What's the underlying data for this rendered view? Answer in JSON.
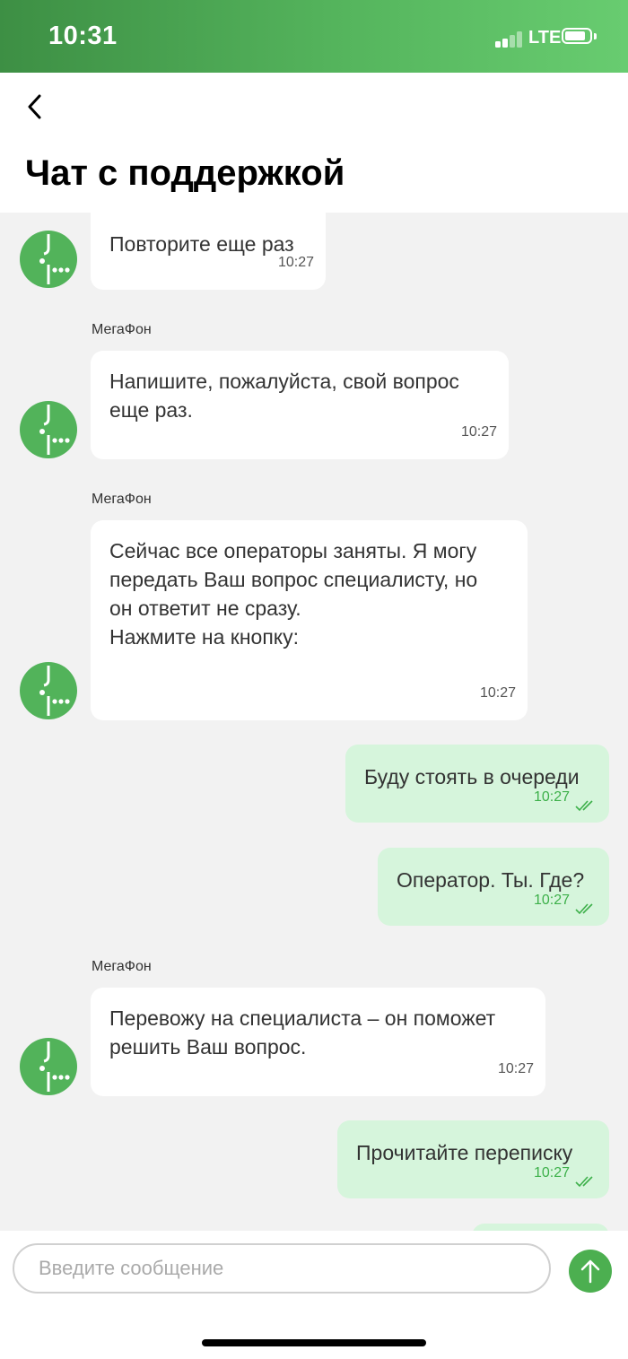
{
  "status_bar": {
    "time": "10:31",
    "network": "LTE"
  },
  "header": {
    "title": "Чат с поддержкой"
  },
  "colors": {
    "brand_green": "#4caf50",
    "outgoing_bubble": "#d6f5dc",
    "incoming_bubble": "#ffffff",
    "read_check": "#3db04a"
  },
  "messages": [
    {
      "direction": "in",
      "sender": "",
      "text": "Повторите еще раз",
      "time": "10:27"
    },
    {
      "direction": "in",
      "sender": "МегаФон",
      "text": "Напишите, пожалуйста, свой вопрос\nеще раз.",
      "time": "10:27"
    },
    {
      "direction": "in",
      "sender": "МегаФон",
      "text": "Сейчас все операторы заняты. Я могу\nпередать Ваш вопрос специалисту, но\nон ответит не сразу.\nНажмите на кнопку:",
      "time": "10:27"
    },
    {
      "direction": "out",
      "text": "Буду стоять в очереди",
      "time": "10:27",
      "status": "read"
    },
    {
      "direction": "out",
      "text": "Оператор. Ты. Где?",
      "time": "10:27",
      "status": "read"
    },
    {
      "direction": "in",
      "sender": "МегаФон",
      "text": "Перевожу на специалиста – он поможет\nрешить Ваш вопрос.",
      "time": "10:27"
    },
    {
      "direction": "out",
      "text": "Прочитайте переписку",
      "time": "10:27",
      "status": "read"
    }
  ],
  "composer": {
    "placeholder": "Введите сообщение"
  }
}
